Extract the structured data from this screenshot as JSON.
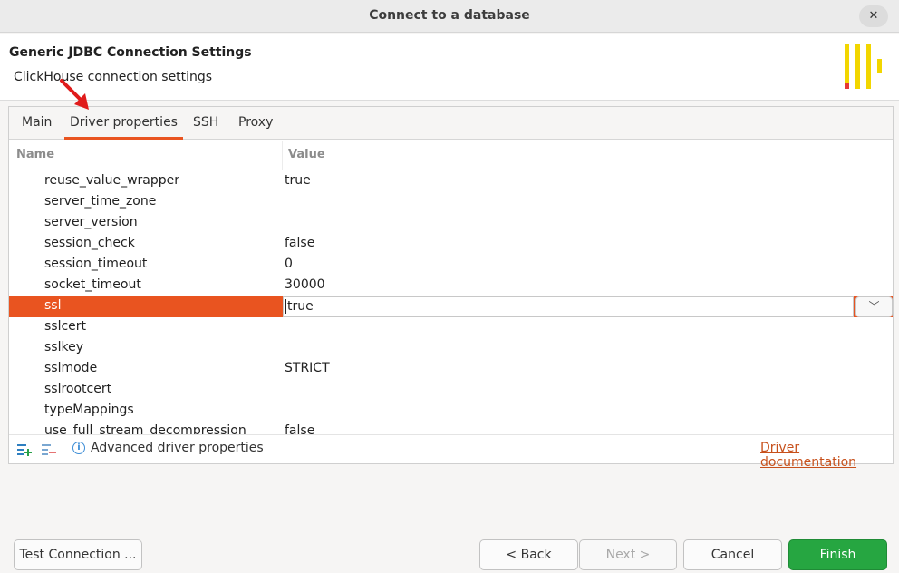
{
  "window": {
    "title": "Connect to a database"
  },
  "header": {
    "title": "Generic JDBC Connection Settings",
    "subtitle": "ClickHouse connection settings"
  },
  "tabs": [
    "Main",
    "Driver properties",
    "SSH",
    "Proxy"
  ],
  "active_tab": "Driver properties",
  "table": {
    "columns": [
      "Name",
      "Value"
    ],
    "rows": [
      {
        "name": "reuse_value_wrapper",
        "value": "true"
      },
      {
        "name": "server_time_zone",
        "value": ""
      },
      {
        "name": "server_version",
        "value": ""
      },
      {
        "name": "session_check",
        "value": "false"
      },
      {
        "name": "session_timeout",
        "value": "0"
      },
      {
        "name": "socket_timeout",
        "value": "30000"
      },
      {
        "name": "ssl",
        "value": "true"
      },
      {
        "name": "sslcert",
        "value": ""
      },
      {
        "name": "sslkey",
        "value": ""
      },
      {
        "name": "sslmode",
        "value": "STRICT"
      },
      {
        "name": "sslrootcert",
        "value": ""
      },
      {
        "name": "typeMappings",
        "value": ""
      },
      {
        "name": "use_full_stream_decompression",
        "value": "false"
      }
    ],
    "selected_row": "ssl"
  },
  "bottom": {
    "advanced_label": "Advanced driver properties",
    "doc_link": "Driver documentation"
  },
  "buttons": {
    "test": "Test Connection ...",
    "back": "< Back",
    "next": "Next >",
    "cancel": "Cancel",
    "finish": "Finish"
  },
  "icons": {
    "close": "close-icon",
    "logo": "clickhouse-logo",
    "annotation": "red-arrow"
  },
  "colors": {
    "accent": "#e95420",
    "finish": "#26a641",
    "link": "#c7501b",
    "logo_yellow": "#f2d600",
    "logo_red": "#e53935"
  }
}
